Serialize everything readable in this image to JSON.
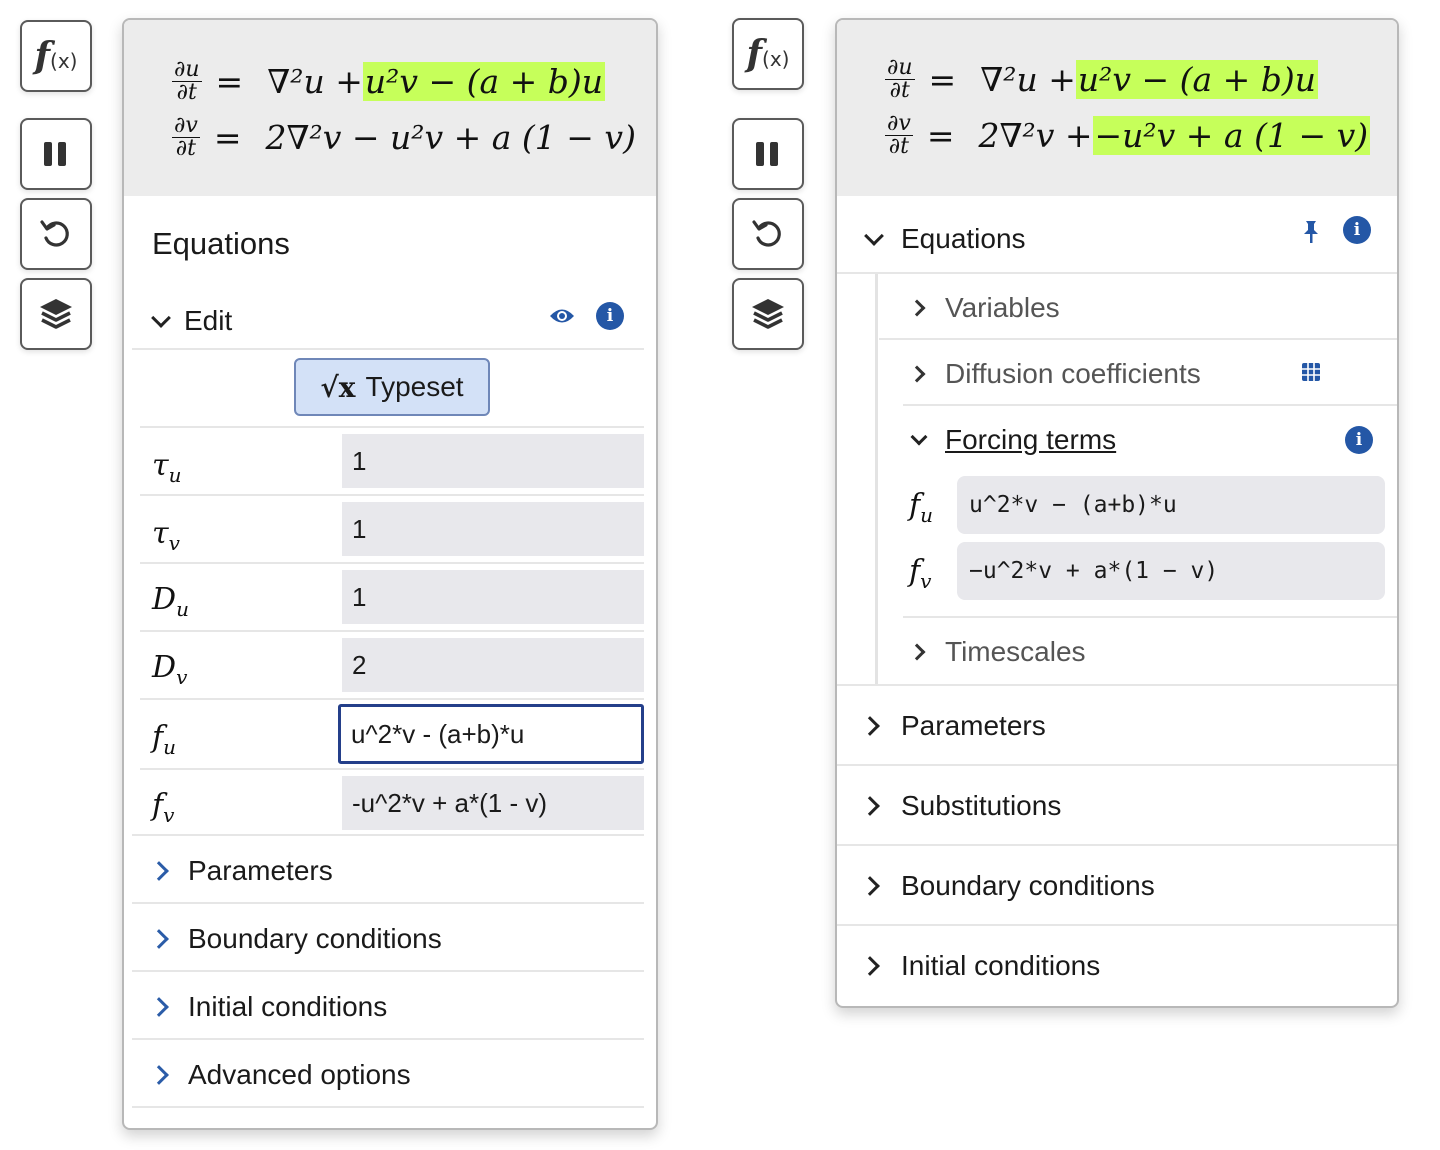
{
  "colors": {
    "highlight": "#c6ff5a",
    "accent": "#2457a6",
    "focus_border": "#243f8a",
    "input_bg": "#e8e8ec"
  },
  "left": {
    "toolbar": {
      "fx_icon": "f",
      "fx_suffix": "(x)",
      "pause": "pause-icon",
      "reset": "reset-icon",
      "layers": "layers-icon"
    },
    "equations": {
      "eq1": {
        "lhs_num": "∂u",
        "lhs_den": "∂t",
        "rhs_plain": "∇²u + ",
        "rhs_highlight": "u²v − (a + b)u"
      },
      "eq2": {
        "lhs_num": "∂v",
        "lhs_den": "∂t",
        "rhs_plain": "2∇²v − u²v + a (1 − v)",
        "rhs_highlight": ""
      }
    },
    "title": "Equations",
    "edit": {
      "label": "Edit",
      "eye_icon": "eye-icon",
      "info_icon": "info-icon"
    },
    "typeset": {
      "icon": "√x",
      "label": "Typeset"
    },
    "params": [
      {
        "sym": "τ",
        "sub": "u",
        "value": "1"
      },
      {
        "sym": "τ",
        "sub": "v",
        "value": "1"
      },
      {
        "sym": "D",
        "sub": "u",
        "value": "1"
      },
      {
        "sym": "D",
        "sub": "v",
        "value": "2"
      },
      {
        "sym": "f",
        "sub": "u",
        "value": "u^2*v - (a+b)*u"
      },
      {
        "sym": "f",
        "sub": "v",
        "value": "-u^2*v + a*(1 - v)"
      }
    ],
    "sections": [
      "Parameters",
      "Boundary conditions",
      "Initial conditions",
      "Advanced options"
    ]
  },
  "right": {
    "toolbar": {
      "fx_icon": "f",
      "fx_suffix": "(x)",
      "pause": "pause-icon",
      "reset": "reset-icon",
      "layers": "layers-icon"
    },
    "equations": {
      "eq1": {
        "lhs_num": "∂u",
        "lhs_den": "∂t",
        "rhs_plain": "∇²u + ",
        "rhs_highlight": "u²v − (a + b)u"
      },
      "eq2": {
        "lhs_num": "∂v",
        "lhs_den": "∂t",
        "rhs_plain": "2∇²v + ",
        "rhs_highlight": "−u²v + a (1 − v)"
      }
    },
    "title": "Equations",
    "subsections": [
      "Variables",
      "Diffusion coefficients"
    ],
    "forcing": {
      "label": "Forcing terms",
      "fu_sym": "f",
      "fu_sub": "u",
      "fu": "u^2*v − (a+b)*u",
      "fv_sym": "f",
      "fv_sub": "v",
      "fv": "−u^2*v + a*(1 − v)"
    },
    "timescales": "Timescales",
    "sections": [
      "Parameters",
      "Substitutions",
      "Boundary conditions",
      "Initial conditions"
    ]
  }
}
